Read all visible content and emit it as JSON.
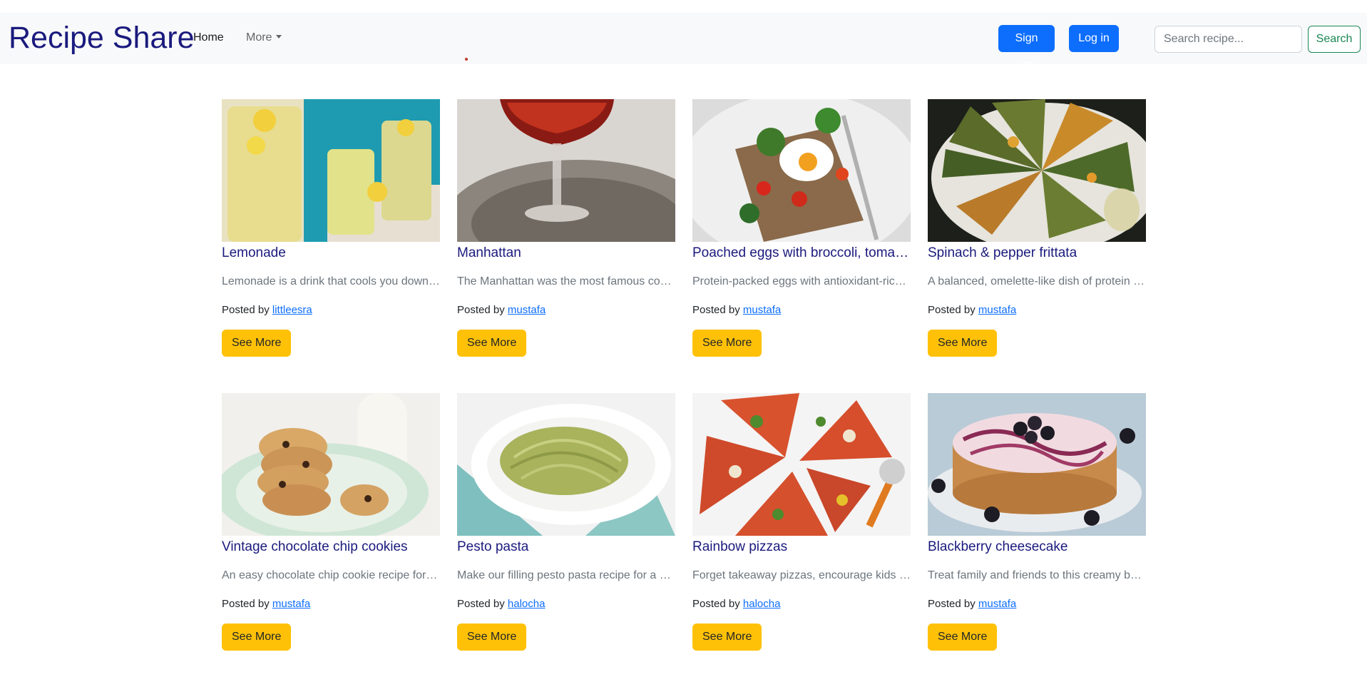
{
  "navbar": {
    "brand": "Recipe Share",
    "home_label": "Home",
    "more_label": "More",
    "signup_label": "Sign up",
    "login_label": "Log in",
    "search_placeholder": "Search recipe...",
    "search_label": "Search"
  },
  "colors": {
    "brand": "#1a1a7e",
    "primary": "#0d6efd",
    "warning": "#ffc107",
    "success": "#198754"
  },
  "cards": [
    {
      "title": "Lemonade",
      "text": "Lemonade is a drink that cools you down on a hot day",
      "posted_prefix": "Posted by",
      "author": "littleesra",
      "button": "See More"
    },
    {
      "title": "Manhattan",
      "text": "The Manhattan was the most famous cocktail",
      "posted_prefix": "Posted by",
      "author": "mustafa",
      "button": "See More"
    },
    {
      "title": "Poached eggs with broccoli, tomatoes & wholemeal flatbread",
      "text": "Protein-packed eggs with antioxidant-rich vegetables",
      "posted_prefix": "Posted by",
      "author": "mustafa",
      "button": "See More"
    },
    {
      "title": "Spinach & pepper frittata",
      "text": "A balanced, omelette-like dish of protein and vegetables",
      "posted_prefix": "Posted by",
      "author": "mustafa",
      "button": "See More"
    },
    {
      "title": "Vintage chocolate chip cookies",
      "text": "An easy chocolate chip cookie recipe for crumbly cookies",
      "posted_prefix": "Posted by",
      "author": "mustafa",
      "button": "See More"
    },
    {
      "title": "Pesto pasta",
      "text": "Make our filling pesto pasta recipe for a quick dinner",
      "posted_prefix": "Posted by",
      "author": "halocha",
      "button": "See More"
    },
    {
      "title": "Rainbow pizzas",
      "text": "Forget takeaway pizzas, encourage kids to make their own",
      "posted_prefix": "Posted by",
      "author": "halocha",
      "button": "See More"
    },
    {
      "title": "Blackberry cheesecake",
      "text": "Treat family and friends to this creamy baked cheesecake",
      "posted_prefix": "Posted by",
      "author": "mustafa",
      "button": "See More"
    }
  ]
}
